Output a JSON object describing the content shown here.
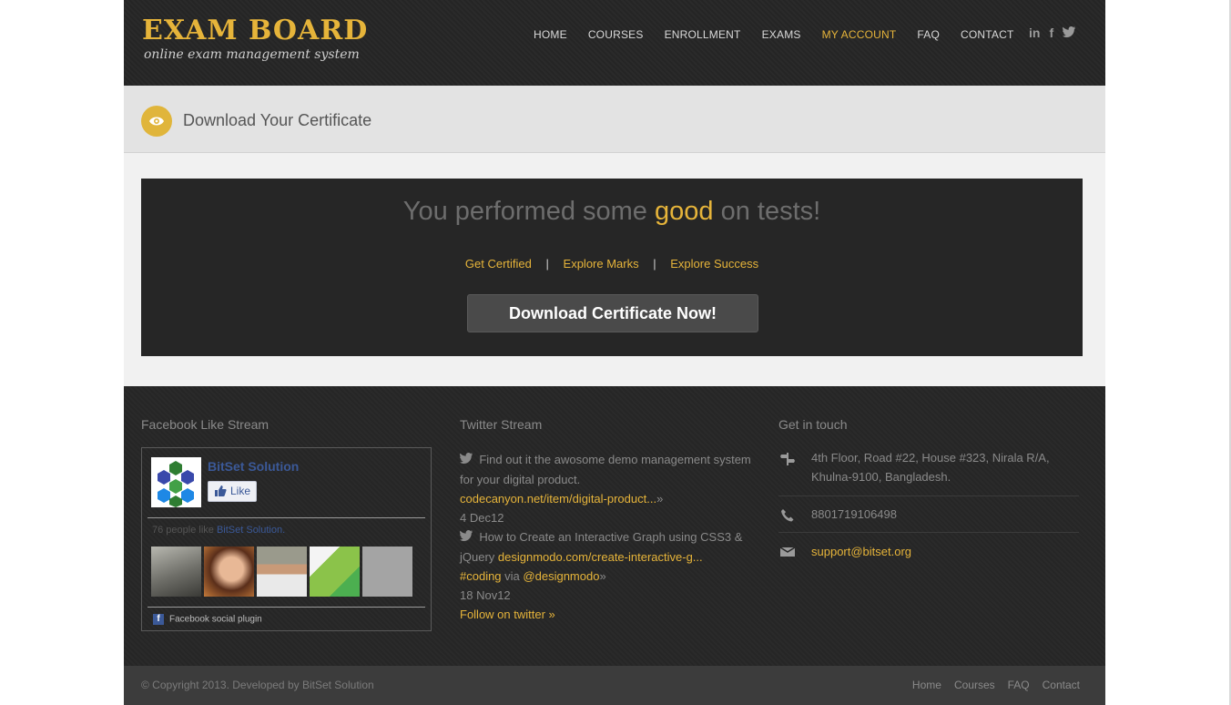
{
  "brand": {
    "title": "EXAM BOARD",
    "subtitle": "online exam management system"
  },
  "nav": {
    "items": [
      "HOME",
      "COURSES",
      "ENROLLMENT",
      "EXAMS",
      "MY ACCOUNT",
      "FAQ",
      "CONTACT"
    ],
    "active": "MY ACCOUNT"
  },
  "social": {
    "linkedin": "in",
    "facebook": "f",
    "twitter": "twitter-icon"
  },
  "page": {
    "title": "Download Your Certificate",
    "icon": "eye-icon"
  },
  "result": {
    "headline_pre": "You performed some",
    "headline_em": "good",
    "headline_post": "on tests!",
    "links": [
      "Get Certified",
      "Explore Marks",
      "Explore Success"
    ],
    "separator": "|",
    "button": "Download Certificate Now!"
  },
  "footer": {
    "facebook": {
      "title": "Facebook Like Stream",
      "page_name": "BitSet Solution",
      "like_label": "Like",
      "count_text": "76 people like",
      "count_page": "BitSet Solution.",
      "plugin_label": "Facebook social plugin"
    },
    "twitter": {
      "title": "Twitter Stream",
      "tweet1_text": "Find out it the awosome demo management system for your digital product.",
      "tweet1_link": "codecanyon.net/item/digital-product...",
      "tweet1_date": "4 Dec12",
      "tweet2_text": "How to Create an Interactive Graph using CSS3 & jQuery",
      "tweet2_link": "designmodo.com/create-interactive-g...",
      "tweet2_tag": "#coding",
      "tweet2_via": "via",
      "tweet2_handle": "@designmodo",
      "tweet2_date": "18 Nov12",
      "follow": "Follow on twitter »",
      "more": "»"
    },
    "contact": {
      "title": "Get in touch",
      "address": "4th Floor, Road #22, House #323, Nirala R/A, Khulna-9100, Bangladesh.",
      "phone": "8801719106498",
      "email": "support@bitset.org"
    }
  },
  "bottom": {
    "copyright": "© Copyright 2013. Developed by BitSet Solution",
    "links": [
      "Home",
      "Courses",
      "FAQ",
      "Contact"
    ]
  },
  "colors": {
    "accent": "#e6b43a",
    "dark": "#262626",
    "facebook": "#3b5998"
  }
}
